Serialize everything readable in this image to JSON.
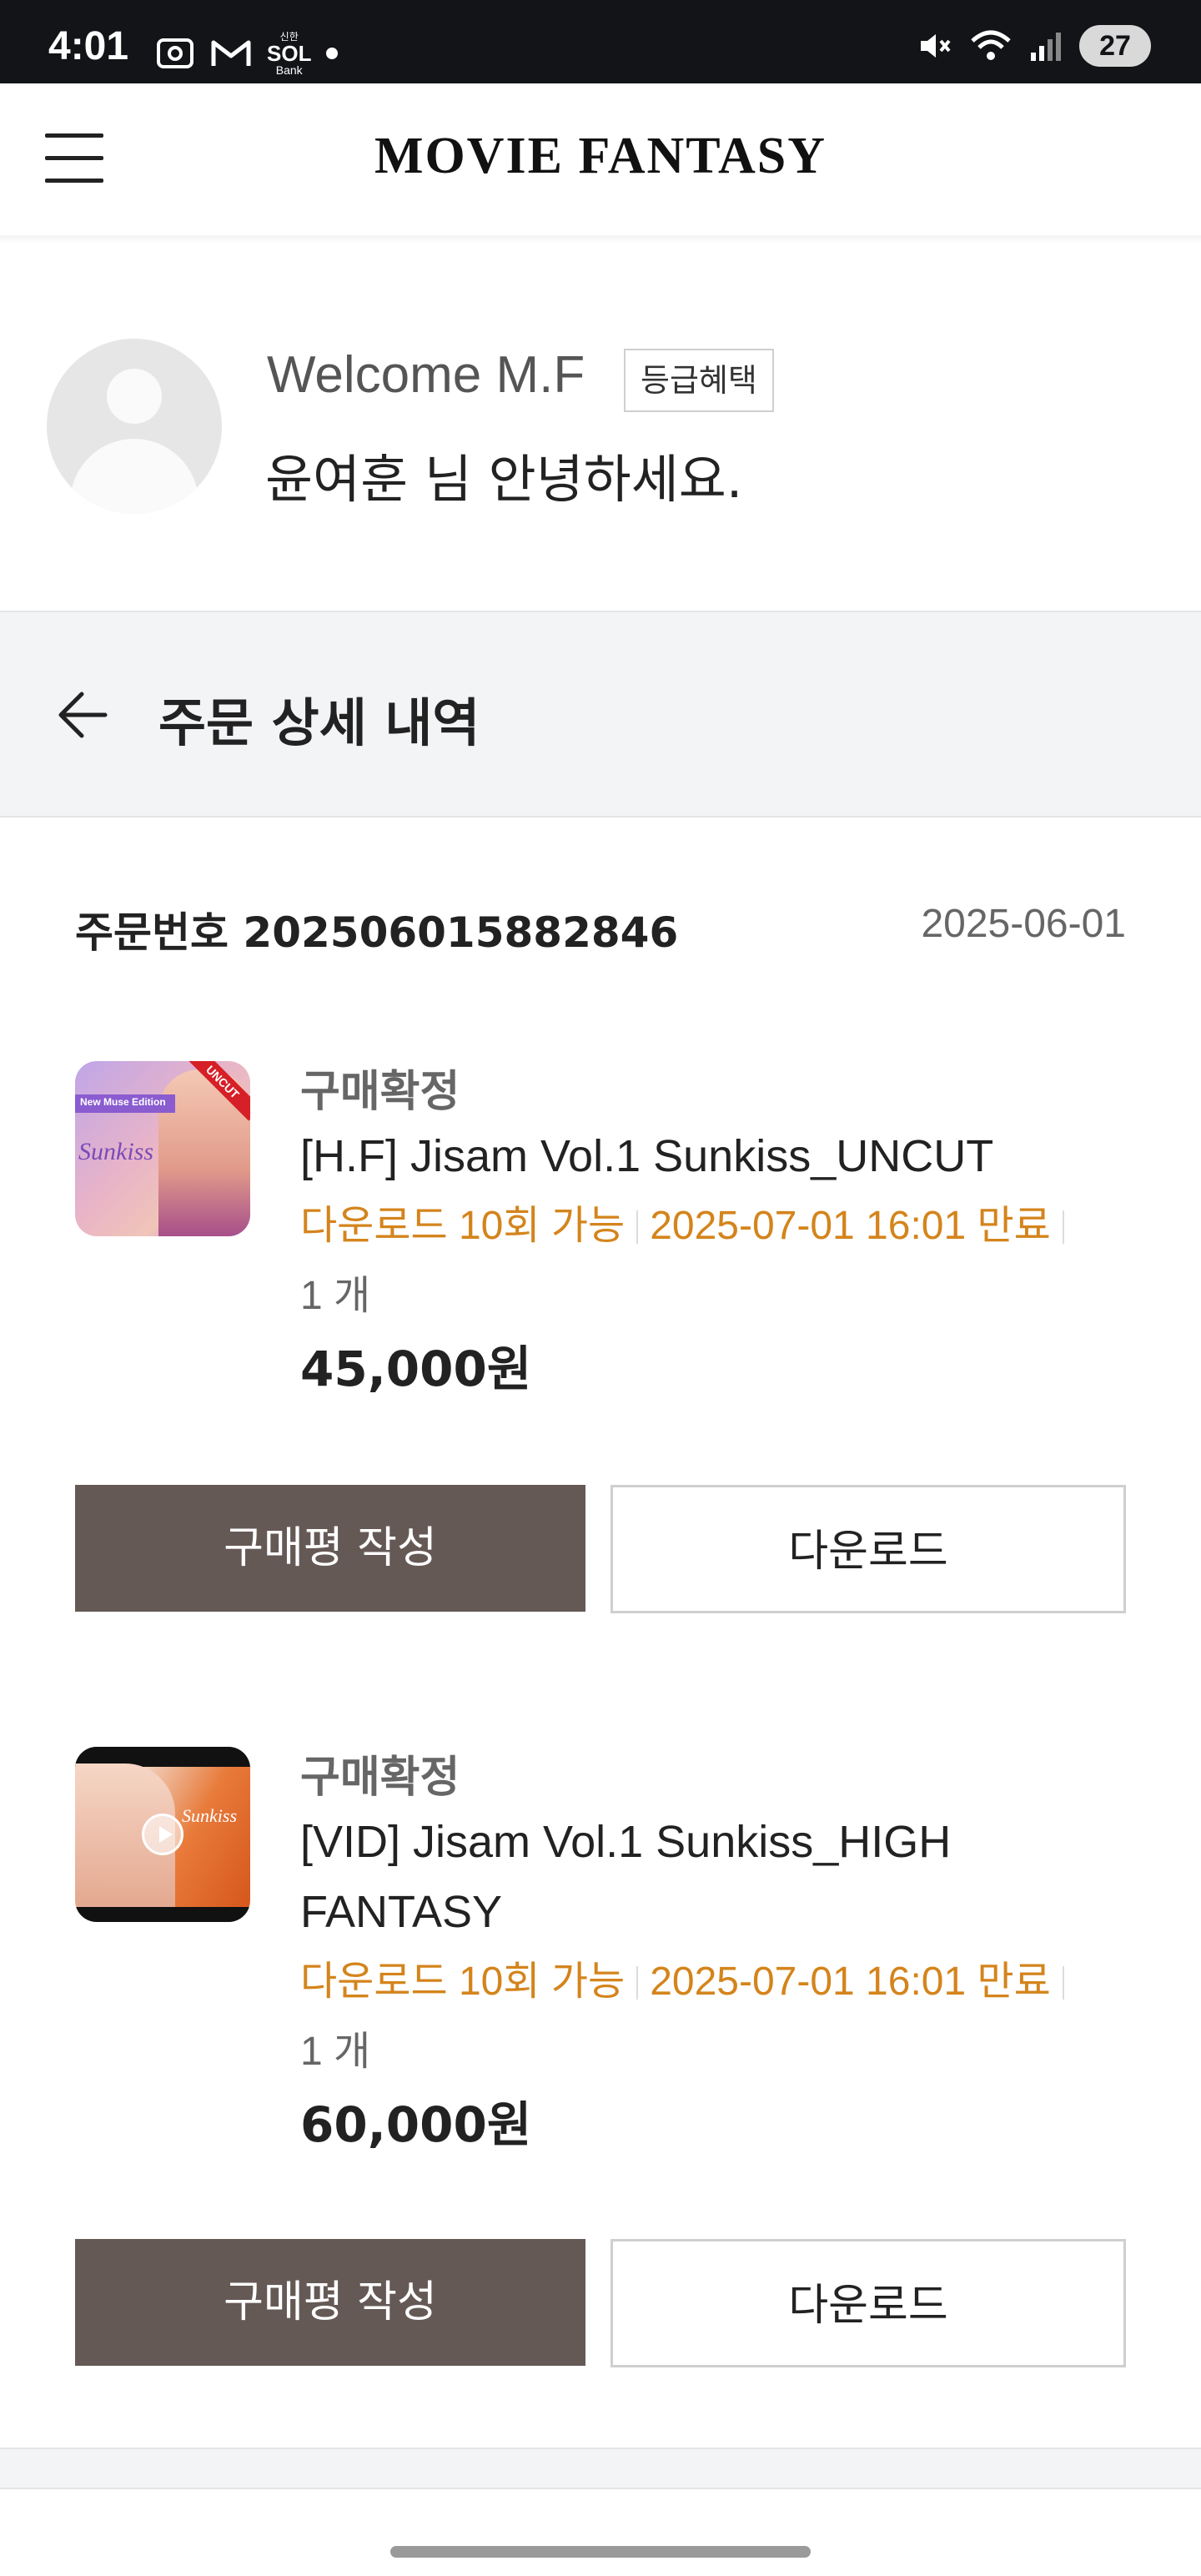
{
  "status_bar": {
    "time": "4:01",
    "bank_label_top": "신한",
    "bank_label_mid": "SOL",
    "bank_label_bottom": "Bank",
    "battery": "27"
  },
  "header": {
    "logo": "MOVIE FANTASY",
    "menu_icon": "hamburger-menu-icon"
  },
  "welcome": {
    "title": "Welcome M.F",
    "grade_button": "등급혜택",
    "greeting": "윤여훈 님 안녕하세요."
  },
  "page": {
    "title": "주문 상세 내역",
    "back_icon": "arrow-left-icon"
  },
  "order": {
    "number_label": "주문번호 202506015882846",
    "date": "2025-06-01",
    "items": [
      {
        "status": "구매확정",
        "name": "[H.F] Jisam Vol.1 Sunkiss_UNCUT",
        "download_count": "다운로드 10회 가능",
        "expiry": "2025-07-01 16:01 만료",
        "quantity": "1 개",
        "price": "45,000원",
        "review_button": "구매평 작성",
        "download_button": "다운로드",
        "thumb_band": "New Muse Edition",
        "thumb_title": "Sunkiss",
        "thumb_ribbon": "UNCUT"
      },
      {
        "status": "구매확정",
        "name_line1": "[VID] Jisam Vol.1 Sunkiss_HIGH",
        "name_line2": "FANTASY",
        "download_count": "다운로드 10회 가능",
        "expiry": "2025-07-01 16:01 만료",
        "quantity": "1 개",
        "price": "60,000원",
        "review_button": "구매평 작성",
        "download_button": "다운로드",
        "thumb_title": "Sunkiss"
      }
    ]
  },
  "colors": {
    "accent_orange": "#d4841c",
    "review_button_bg": "#655956",
    "status_bar_bg": "#121417"
  }
}
